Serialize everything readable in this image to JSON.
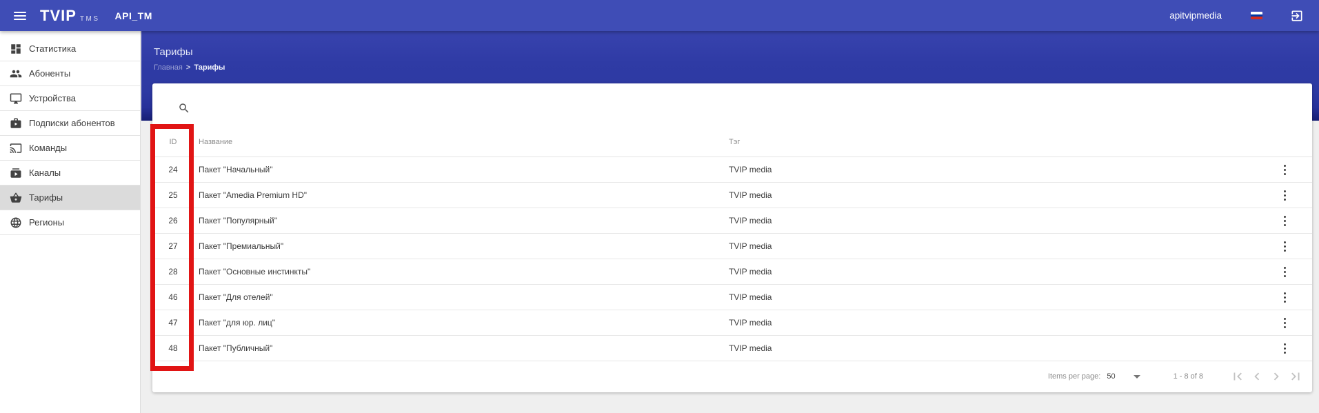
{
  "app_bar": {
    "logo_text": "TVIP",
    "logo_sub": "TMS",
    "env_label": "API_TM",
    "username": "apitvipmedia",
    "icons": [
      "menu-icon",
      "flag-ru-icon",
      "logout-icon"
    ]
  },
  "sidebar": {
    "items": [
      {
        "icon": "dashboard-icon",
        "label": "Статистика"
      },
      {
        "icon": "people-icon",
        "label": "Абоненты"
      },
      {
        "icon": "device-monitor-icon",
        "label": "Устройства"
      },
      {
        "icon": "briefcase-play-icon",
        "label": "Подписки абонентов"
      },
      {
        "icon": "cast-icon",
        "label": "Команды"
      },
      {
        "icon": "channels-play-icon",
        "label": "Каналы"
      },
      {
        "icon": "basket-icon",
        "label": "Тарифы"
      },
      {
        "icon": "globe-icon",
        "label": "Регионы"
      }
    ],
    "active_label": "Тарифы"
  },
  "page_header": {
    "title": "Тарифы",
    "breadcrumb": {
      "root": "Главная",
      "separator": ">",
      "current": "Тарифы"
    }
  },
  "table": {
    "columns": {
      "id": "ID",
      "name": "Название",
      "tag": "Тэг"
    },
    "rows": [
      {
        "id": "24",
        "name": "Пакет \"Начальный\"",
        "tag": "TVIP media"
      },
      {
        "id": "25",
        "name": "Пакет \"Amedia Premium HD\"",
        "tag": "TVIP media"
      },
      {
        "id": "26",
        "name": "Пакет \"Популярный\"",
        "tag": "TVIP media"
      },
      {
        "id": "27",
        "name": "Пакет \"Премиальный\"",
        "tag": "TVIP media"
      },
      {
        "id": "28",
        "name": "Пакет \"Основные инстинкты\"",
        "tag": "TVIP media"
      },
      {
        "id": "46",
        "name": "Пакет \"Для отелей\"",
        "tag": "TVIP media"
      },
      {
        "id": "47",
        "name": "Пакет \"для юр. лиц\"",
        "tag": "TVIP media"
      },
      {
        "id": "48",
        "name": "Пакет \"Публичный\"",
        "tag": "TVIP media"
      }
    ],
    "row_menu_icon": "kebab-menu-icon"
  },
  "footer": {
    "items_per_page_label": "Items per page:",
    "items_per_page_value": "50",
    "range_label": "1 - 8 of 8",
    "pagination_icons": [
      "first-page-icon",
      "prev-page-icon",
      "next-page-icon",
      "last-page-icon"
    ]
  },
  "annotation": {
    "shape": "red-rectangle-around-id-column",
    "color": "#e11414"
  },
  "colors": {
    "appbar": "#3f4db6",
    "band_top": "#3843ae",
    "band_bottom": "#161e74",
    "content_bg": "#efefef",
    "sidebar_active_bg": "#dbdbdb",
    "flag_white": "#ffffff",
    "flag_blue": "#0039a6",
    "flag_red": "#d52b1e"
  }
}
